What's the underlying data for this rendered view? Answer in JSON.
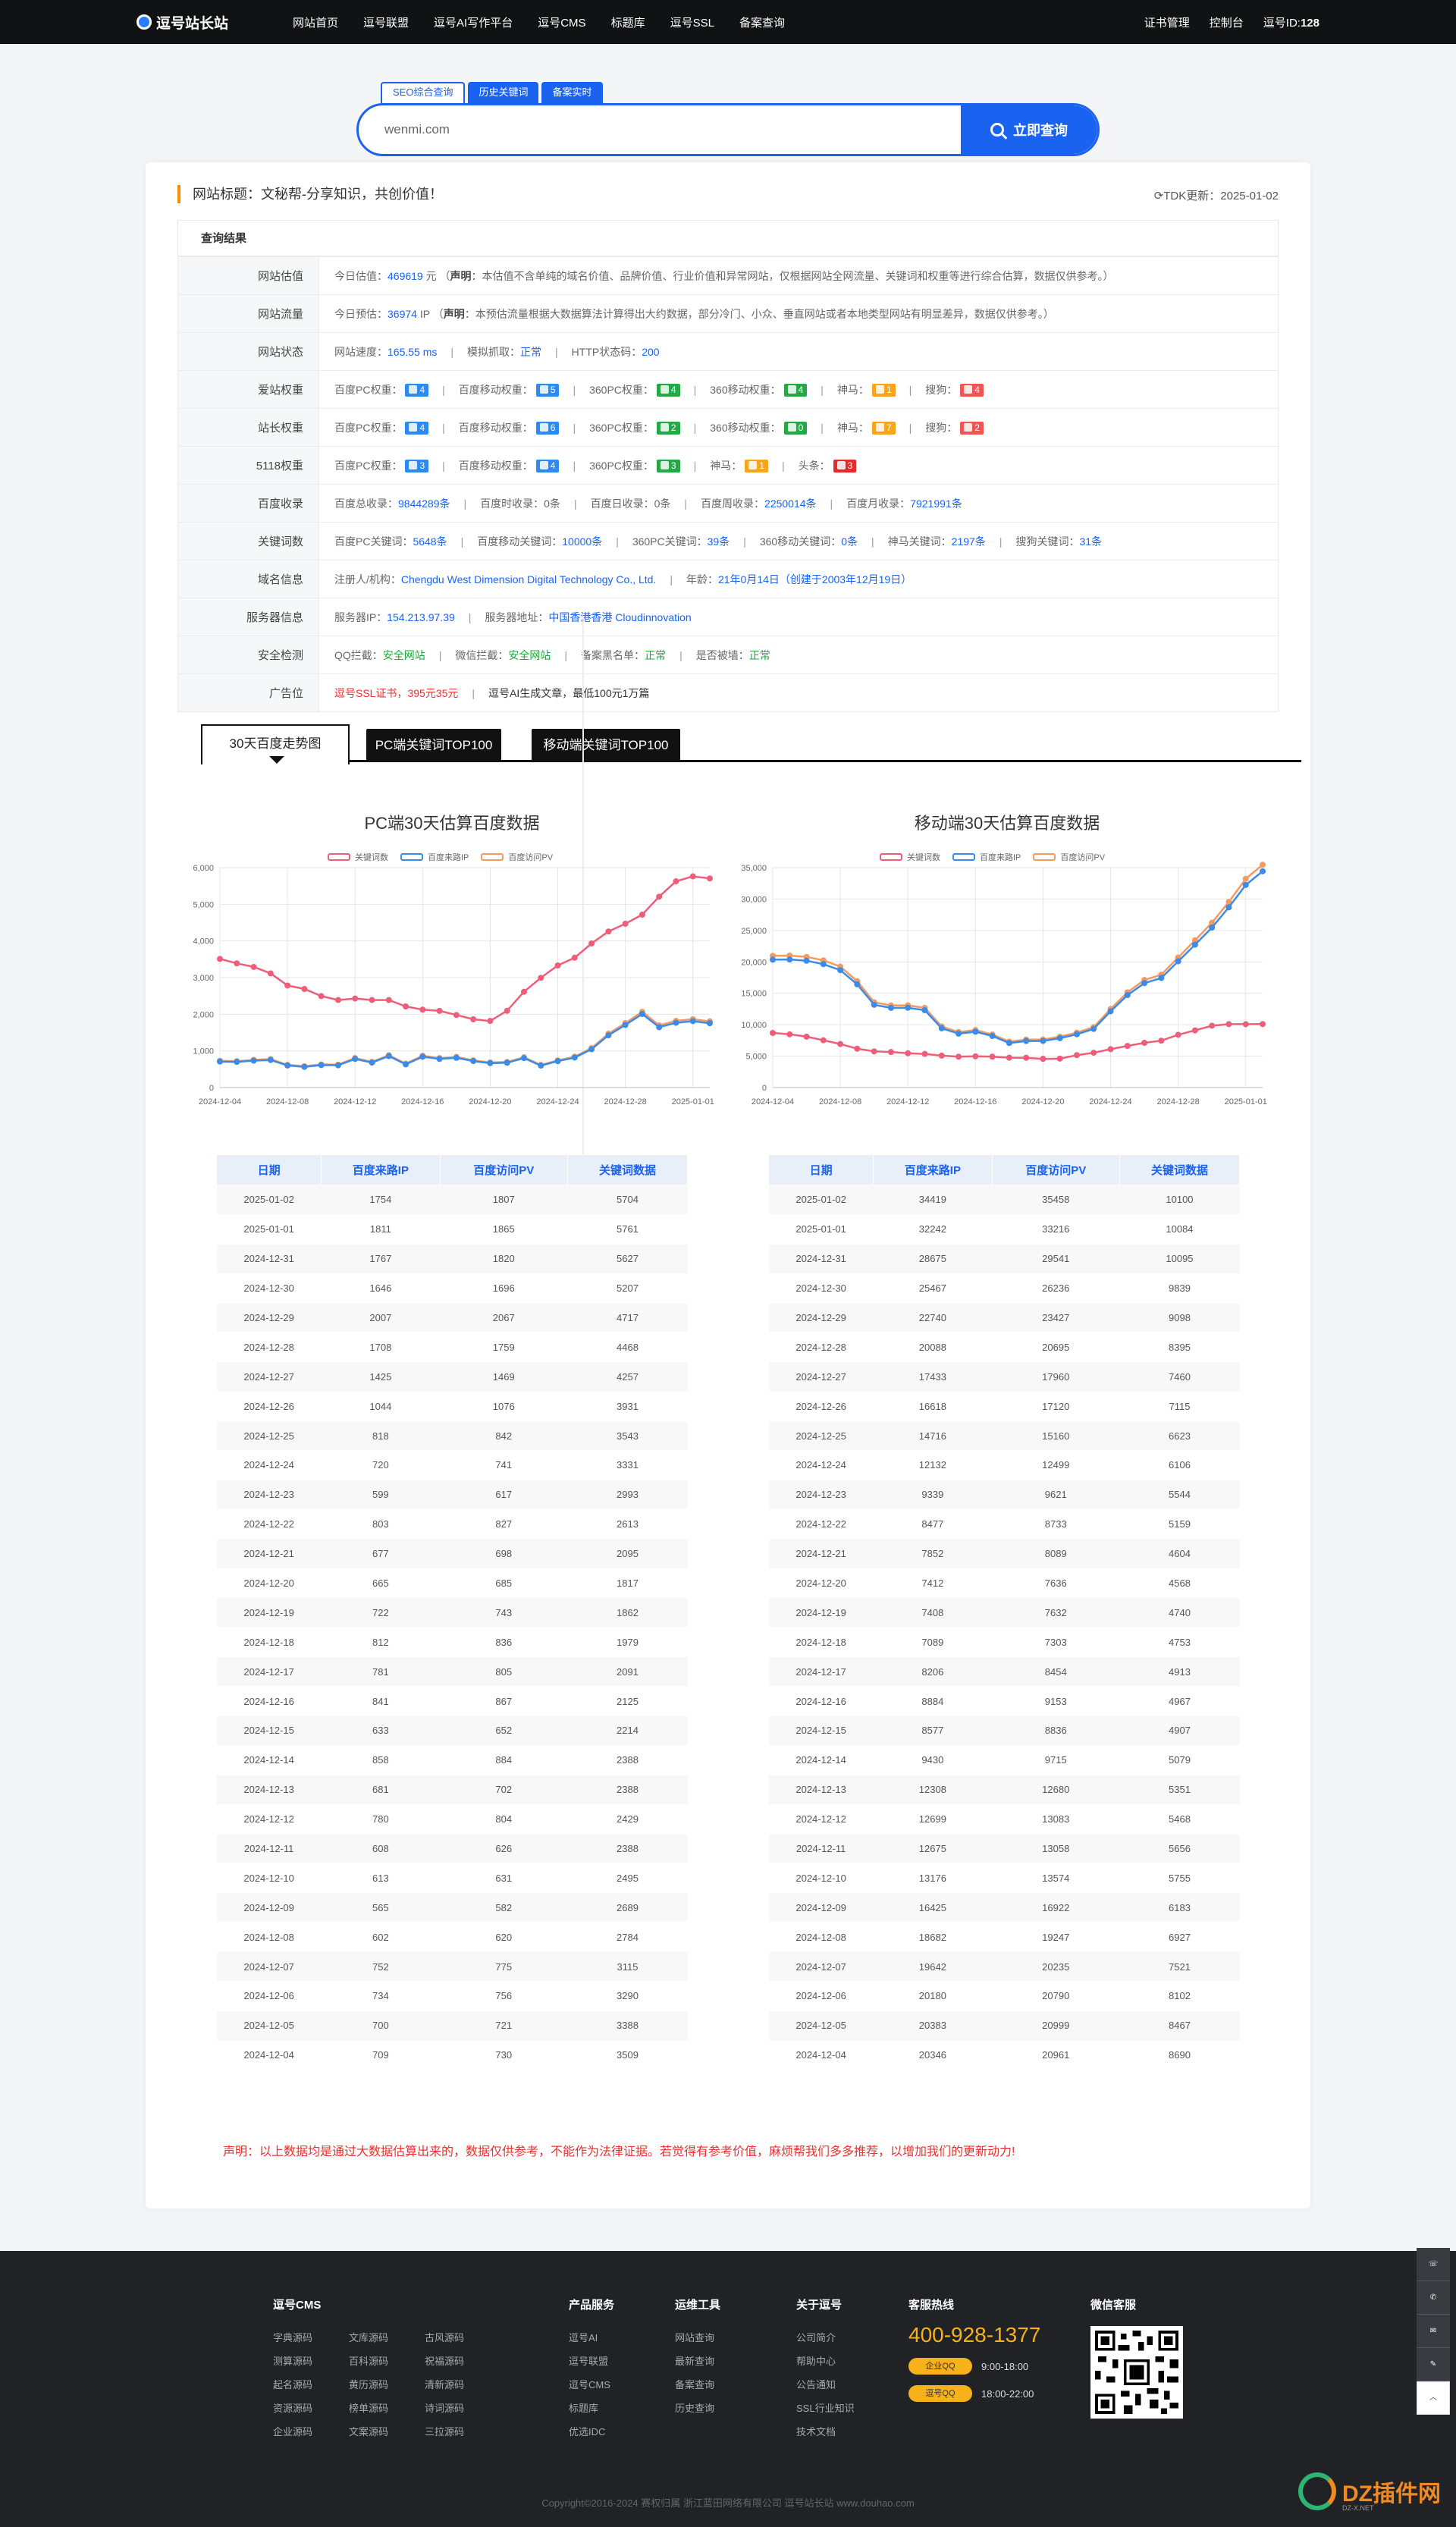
{
  "nav": {
    "logo": "逗号站长站",
    "links": [
      "网站首页",
      "逗号联盟",
      "逗号AI写作平台",
      "逗号CMS",
      "标题库",
      "逗号SSL",
      "备案查询"
    ],
    "right": [
      "证书管理",
      "控制台"
    ],
    "id_label": "逗号ID:",
    "id_value": "128"
  },
  "search": {
    "tabs": [
      "SEO综合查询",
      "历史关键词",
      "备案实时"
    ],
    "value": "wenmi.com",
    "button": "立即查询"
  },
  "site": {
    "title": "网站标题：文秘帮-分享知识，共创价值！",
    "tdk_update": "TDK更新：2025-01-02",
    "result_head": "查询结果"
  },
  "info": {
    "gujia": {
      "label": "网站估值",
      "pre": "今日估值：",
      "value": "469619",
      "unit": " 元 （",
      "decl": "声明",
      "text": "：本估值不含单纯的域名价值、品牌价值、行业价值和异常网站，仅根据网站全网流量、关键词和权重等进行综合估算，数据仅供参考。）"
    },
    "liuliang": {
      "label": "网站流量",
      "pre": "今日预估：",
      "value": "36974",
      "unit": " IP （",
      "decl": "声明",
      "text": "：本预估流量根据大数据算法计算得出大约数据，部分冷门、小众、垂直网站或者本地类型网站有明显差异，数据仅供参考。）"
    },
    "status": {
      "label": "网站状态",
      "speed_label": "网站速度：",
      "speed": "165.55 ms",
      "crawl_label": "模拟抓取：",
      "crawl": "正常",
      "http_label": "HTTP状态码：",
      "http": "200"
    },
    "aizhan": {
      "label": "爱站权重",
      "items": [
        {
          "name": "百度PC权重：",
          "val": "4",
          "color": "blue"
        },
        {
          "name": "百度移动权重：",
          "val": "5",
          "color": "blue"
        },
        {
          "name": "360PC权重：",
          "val": "4",
          "color": "green"
        },
        {
          "name": "360移动权重：",
          "val": "4",
          "color": "green"
        },
        {
          "name": "神马：",
          "val": "1",
          "color": "orange"
        },
        {
          "name": "搜狗：",
          "val": "4",
          "color": "red"
        }
      ]
    },
    "zhanzhang": {
      "label": "站长权重",
      "items": [
        {
          "name": "百度PC权重：",
          "val": "4",
          "color": "blue"
        },
        {
          "name": "百度移动权重：",
          "val": "6",
          "color": "blue"
        },
        {
          "name": "360PC权重：",
          "val": "2",
          "color": "green"
        },
        {
          "name": "360移动权重：",
          "val": "0",
          "color": "green"
        },
        {
          "name": "神马：",
          "val": "7",
          "color": "orange"
        },
        {
          "name": "搜狗：",
          "val": "2",
          "color": "red"
        }
      ]
    },
    "w5118": {
      "label": "5118权重",
      "items": [
        {
          "name": "百度PC权重：",
          "val": "3",
          "color": "blue"
        },
        {
          "name": "百度移动权重：",
          "val": "4",
          "color": "blue"
        },
        {
          "name": "360PC权重：",
          "val": "3",
          "color": "green"
        },
        {
          "name": "神马：",
          "val": "1",
          "color": "orange"
        },
        {
          "name": "头条：",
          "val": "3",
          "color": "redd"
        }
      ]
    },
    "shoulu": {
      "label": "百度收录",
      "items": [
        {
          "name": "百度总收录：",
          "val": "9844289条",
          "color": "blue"
        },
        {
          "name": "百度时收录：",
          "val": "0条",
          "color": "plain"
        },
        {
          "name": "百度日收录：",
          "val": "0条",
          "color": "plain"
        },
        {
          "name": "百度周收录：",
          "val": "2250014条",
          "color": "blue"
        },
        {
          "name": "百度月收录：",
          "val": "7921991条",
          "color": "blue"
        }
      ]
    },
    "keywords": {
      "label": "关键词数",
      "items": [
        {
          "name": "百度PC关键词：",
          "val": "5648条"
        },
        {
          "name": "百度移动关键词：",
          "val": "10000条"
        },
        {
          "name": "360PC关键词：",
          "val": "39条"
        },
        {
          "name": "360移动关键词：",
          "val": "0条"
        },
        {
          "name": "神马关键词：",
          "val": "2197条"
        },
        {
          "name": "搜狗关键词：",
          "val": "31条"
        }
      ]
    },
    "domain": {
      "label": "域名信息",
      "org_label": "注册人/机构：",
      "org": "Chengdu West Dimension Digital Technology Co., Ltd.",
      "age_label": "年龄：",
      "age": "21年0月14日（创建于2003年12月19日）"
    },
    "server": {
      "label": "服务器信息",
      "ip_label": "服务器IP：",
      "ip": "154.213.97.39",
      "addr_label": "服务器地址：",
      "addr": "中国香港香港 Cloudinnovation"
    },
    "security": {
      "label": "安全检测",
      "items": [
        {
          "name": "QQ拦截：",
          "val": "安全网站"
        },
        {
          "name": "微信拦截：",
          "val": "安全网站"
        },
        {
          "name": "备案黑名单：",
          "val": "正常"
        },
        {
          "name": "是否被墙：",
          "val": "正常"
        }
      ]
    },
    "ad": {
      "label": "广告位",
      "left": "逗号SSL证书，395元35元",
      "right": "逗号AI生成文章，最低100元1万篇"
    }
  },
  "chart_tabs": [
    "30天百度走势图",
    "PC端关键词TOP100",
    "移动端关键词TOP100"
  ],
  "legend": [
    "关键词数",
    "百度来路IP",
    "百度访问PV"
  ],
  "colors": {
    "keywords": "#ee5e78",
    "ip": "#3b8be8",
    "pv": "#f29a62",
    "brand": "#1a63f0"
  },
  "chart_data": [
    {
      "type": "line",
      "title": "PC端30天估算百度数据",
      "x": [
        "2024-12-04",
        "2024-12-05",
        "2024-12-06",
        "2024-12-07",
        "2024-12-08",
        "2024-12-09",
        "2024-12-10",
        "2024-12-11",
        "2024-12-12",
        "2024-12-13",
        "2024-12-14",
        "2024-12-15",
        "2024-12-16",
        "2024-12-17",
        "2024-12-18",
        "2024-12-19",
        "2024-12-20",
        "2024-12-21",
        "2024-12-22",
        "2024-12-23",
        "2024-12-24",
        "2024-12-25",
        "2024-12-26",
        "2024-12-27",
        "2024-12-28",
        "2024-12-29",
        "2024-12-30",
        "2024-12-31",
        "2025-01-01",
        "2025-01-02"
      ],
      "xticks": [
        "2024-12-04",
        "2024-12-08",
        "2024-12-12",
        "2024-12-16",
        "2024-12-20",
        "2024-12-24",
        "2024-12-28",
        "2025-01-01"
      ],
      "ylim": [
        0,
        6000
      ],
      "yticks": [
        "0",
        "1,000",
        "2,000",
        "3,000",
        "4,000",
        "5,000",
        "6,000"
      ],
      "series": [
        {
          "name": "关键词数",
          "values": [
            3509,
            3388,
            3290,
            3115,
            2784,
            2689,
            2495,
            2388,
            2429,
            2388,
            2388,
            2214,
            2125,
            2091,
            1979,
            1862,
            1817,
            2095,
            2613,
            2993,
            3331,
            3543,
            3931,
            4257,
            4468,
            4717,
            5207,
            5627,
            5761,
            5704
          ]
        },
        {
          "name": "百度来路IP",
          "values": [
            709,
            700,
            734,
            752,
            602,
            565,
            613,
            608,
            780,
            681,
            858,
            633,
            841,
            781,
            812,
            722,
            665,
            677,
            803,
            599,
            720,
            818,
            1044,
            1425,
            1708,
            2007,
            1646,
            1767,
            1811,
            1754
          ]
        },
        {
          "name": "百度访问PV",
          "values": [
            730,
            721,
            756,
            775,
            620,
            582,
            631,
            626,
            804,
            702,
            884,
            652,
            867,
            805,
            836,
            743,
            685,
            698,
            827,
            617,
            741,
            842,
            1076,
            1469,
            1759,
            2067,
            1696,
            1820,
            1865,
            1807
          ]
        }
      ]
    },
    {
      "type": "line",
      "title": "移动端30天估算百度数据",
      "x": [
        "2024-12-04",
        "2024-12-05",
        "2024-12-06",
        "2024-12-07",
        "2024-12-08",
        "2024-12-09",
        "2024-12-10",
        "2024-12-11",
        "2024-12-12",
        "2024-12-13",
        "2024-12-14",
        "2024-12-15",
        "2024-12-16",
        "2024-12-17",
        "2024-12-18",
        "2024-12-19",
        "2024-12-20",
        "2024-12-21",
        "2024-12-22",
        "2024-12-23",
        "2024-12-24",
        "2024-12-25",
        "2024-12-26",
        "2024-12-27",
        "2024-12-28",
        "2024-12-29",
        "2024-12-30",
        "2024-12-31",
        "2025-01-01",
        "2025-01-02"
      ],
      "xticks": [
        "2024-12-04",
        "2024-12-08",
        "2024-12-12",
        "2024-12-16",
        "2024-12-20",
        "2024-12-24",
        "2024-12-28",
        "2025-01-01"
      ],
      "ylim": [
        0,
        35000
      ],
      "yticks": [
        "0",
        "5,000",
        "10,000",
        "15,000",
        "20,000",
        "25,000",
        "30,000",
        "35,000"
      ],
      "series": [
        {
          "name": "关键词数",
          "values": [
            8690,
            8467,
            8102,
            7521,
            6927,
            6183,
            5755,
            5656,
            5468,
            5351,
            5079,
            4907,
            4967,
            4913,
            4753,
            4740,
            4568,
            4604,
            5159,
            5544,
            6106,
            6623,
            7115,
            7460,
            8395,
            9098,
            9839,
            10095,
            10084,
            10100
          ]
        },
        {
          "name": "百度来路IP",
          "values": [
            20346,
            20383,
            20180,
            19642,
            18682,
            16425,
            13176,
            12675,
            12699,
            12308,
            9430,
            8577,
            8884,
            8206,
            7089,
            7408,
            7412,
            7852,
            8477,
            9339,
            12132,
            14716,
            16618,
            17433,
            20088,
            22740,
            25467,
            28675,
            32242,
            34419
          ]
        },
        {
          "name": "百度访问PV",
          "values": [
            20961,
            20999,
            20790,
            20235,
            19247,
            16922,
            13574,
            13058,
            13083,
            12680,
            9715,
            8836,
            9153,
            8454,
            7303,
            7632,
            7636,
            8089,
            8733,
            9621,
            12499,
            15160,
            17120,
            17960,
            20695,
            23427,
            26236,
            29541,
            33216,
            35458
          ]
        }
      ]
    }
  ],
  "tables": {
    "headers": [
      "日期",
      "百度来路IP",
      "百度访问PV",
      "关键词数据"
    ],
    "pc": [
      [
        "2025-01-02",
        "1754",
        "1807",
        "5704"
      ],
      [
        "2025-01-01",
        "1811",
        "1865",
        "5761"
      ],
      [
        "2024-12-31",
        "1767",
        "1820",
        "5627"
      ],
      [
        "2024-12-30",
        "1646",
        "1696",
        "5207"
      ],
      [
        "2024-12-29",
        "2007",
        "2067",
        "4717"
      ],
      [
        "2024-12-28",
        "1708",
        "1759",
        "4468"
      ],
      [
        "2024-12-27",
        "1425",
        "1469",
        "4257"
      ],
      [
        "2024-12-26",
        "1044",
        "1076",
        "3931"
      ],
      [
        "2024-12-25",
        "818",
        "842",
        "3543"
      ],
      [
        "2024-12-24",
        "720",
        "741",
        "3331"
      ],
      [
        "2024-12-23",
        "599",
        "617",
        "2993"
      ],
      [
        "2024-12-22",
        "803",
        "827",
        "2613"
      ],
      [
        "2024-12-21",
        "677",
        "698",
        "2095"
      ],
      [
        "2024-12-20",
        "665",
        "685",
        "1817"
      ],
      [
        "2024-12-19",
        "722",
        "743",
        "1862"
      ],
      [
        "2024-12-18",
        "812",
        "836",
        "1979"
      ],
      [
        "2024-12-17",
        "781",
        "805",
        "2091"
      ],
      [
        "2024-12-16",
        "841",
        "867",
        "2125"
      ],
      [
        "2024-12-15",
        "633",
        "652",
        "2214"
      ],
      [
        "2024-12-14",
        "858",
        "884",
        "2388"
      ],
      [
        "2024-12-13",
        "681",
        "702",
        "2388"
      ],
      [
        "2024-12-12",
        "780",
        "804",
        "2429"
      ],
      [
        "2024-12-11",
        "608",
        "626",
        "2388"
      ],
      [
        "2024-12-10",
        "613",
        "631",
        "2495"
      ],
      [
        "2024-12-09",
        "565",
        "582",
        "2689"
      ],
      [
        "2024-12-08",
        "602",
        "620",
        "2784"
      ],
      [
        "2024-12-07",
        "752",
        "775",
        "3115"
      ],
      [
        "2024-12-06",
        "734",
        "756",
        "3290"
      ],
      [
        "2024-12-05",
        "700",
        "721",
        "3388"
      ],
      [
        "2024-12-04",
        "709",
        "730",
        "3509"
      ]
    ],
    "mobile": [
      [
        "2025-01-02",
        "34419",
        "35458",
        "10100"
      ],
      [
        "2025-01-01",
        "32242",
        "33216",
        "10084"
      ],
      [
        "2024-12-31",
        "28675",
        "29541",
        "10095"
      ],
      [
        "2024-12-30",
        "25467",
        "26236",
        "9839"
      ],
      [
        "2024-12-29",
        "22740",
        "23427",
        "9098"
      ],
      [
        "2024-12-28",
        "20088",
        "20695",
        "8395"
      ],
      [
        "2024-12-27",
        "17433",
        "17960",
        "7460"
      ],
      [
        "2024-12-26",
        "16618",
        "17120",
        "7115"
      ],
      [
        "2024-12-25",
        "14716",
        "15160",
        "6623"
      ],
      [
        "2024-12-24",
        "12132",
        "12499",
        "6106"
      ],
      [
        "2024-12-23",
        "9339",
        "9621",
        "5544"
      ],
      [
        "2024-12-22",
        "8477",
        "8733",
        "5159"
      ],
      [
        "2024-12-21",
        "7852",
        "8089",
        "4604"
      ],
      [
        "2024-12-20",
        "7412",
        "7636",
        "4568"
      ],
      [
        "2024-12-19",
        "7408",
        "7632",
        "4740"
      ],
      [
        "2024-12-18",
        "7089",
        "7303",
        "4753"
      ],
      [
        "2024-12-17",
        "8206",
        "8454",
        "4913"
      ],
      [
        "2024-12-16",
        "8884",
        "9153",
        "4967"
      ],
      [
        "2024-12-15",
        "8577",
        "8836",
        "4907"
      ],
      [
        "2024-12-14",
        "9430",
        "9715",
        "5079"
      ],
      [
        "2024-12-13",
        "12308",
        "12680",
        "5351"
      ],
      [
        "2024-12-12",
        "12699",
        "13083",
        "5468"
      ],
      [
        "2024-12-11",
        "12675",
        "13058",
        "5656"
      ],
      [
        "2024-12-10",
        "13176",
        "13574",
        "5755"
      ],
      [
        "2024-12-09",
        "16425",
        "16922",
        "6183"
      ],
      [
        "2024-12-08",
        "18682",
        "19247",
        "6927"
      ],
      [
        "2024-12-07",
        "19642",
        "20235",
        "7521"
      ],
      [
        "2024-12-06",
        "20180",
        "20790",
        "8102"
      ],
      [
        "2024-12-05",
        "20383",
        "20999",
        "8467"
      ],
      [
        "2024-12-04",
        "20346",
        "20961",
        "8690"
      ]
    ]
  },
  "disclaimer": "声明：以上数据均是通过大数据估算出来的，数据仅供参考，不能作为法律证据。若觉得有参考价值，麻烦帮我们多多推荐，以增加我们的更新动力!",
  "footer": {
    "cms": {
      "title": "逗号CMS",
      "links": [
        "字典源码",
        "文库源码",
        "古风源码",
        "测算源码",
        "百科源码",
        "祝福源码",
        "起名源码",
        "黄历源码",
        "清新源码",
        "资源源码",
        "榜单源码",
        "诗词源码",
        "企业源码",
        "文案源码",
        "三拉源码"
      ]
    },
    "products": {
      "title": "产品服务",
      "links": [
        "逗号AI",
        "逗号联盟",
        "逗号CMS",
        "标题库",
        "优选IDC"
      ]
    },
    "ops": {
      "title": "运维工具",
      "links": [
        "网站查询",
        "最新查询",
        "备案查询",
        "历史查询"
      ]
    },
    "about": {
      "title": "关于逗号",
      "links": [
        "公司简介",
        "帮助中心",
        "公告通知",
        "SSL行业知识",
        "技术文档"
      ]
    },
    "hotline": {
      "title": "客服热线",
      "phone": "400-928-1377",
      "qq1": "企业QQ",
      "time1": "9:00-18:00",
      "qq2": "逗号QQ",
      "time2": "18:00-22:00"
    },
    "wechat": {
      "title": "微信客服"
    },
    "copyright": "Copyright©2016-2024 赛权归属 浙江蓝田网络有限公司 逗号站长站 www.douhao.com",
    "side": [
      "返回\n顶部"
    ],
    "dz": {
      "text": "DZ插件网",
      "sub": "DZ-X.NET"
    }
  }
}
